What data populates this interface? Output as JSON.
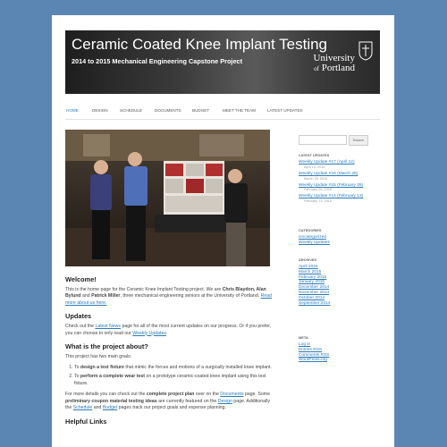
{
  "header": {
    "title": "Ceramic Coated Knee Implant Testing",
    "subtitle": "2014 to 2015 Mechanical Engineering Capstone Project",
    "logo_university": "University",
    "logo_of": "of",
    "logo_portland": "Portland"
  },
  "nav": {
    "items": [
      "HOME",
      "DESIGN",
      "SCHEDULE",
      "DOCUMENTS",
      "BUDGET",
      "MEET THE TEAM",
      "LATEST UPDATES"
    ]
  },
  "main": {
    "welcome_title": "Welcome!",
    "welcome_p1": "This is the home page for the Ceramic Knee Implant Testing project. We are ",
    "names1": "Chris Blaydon, Alan Bylund",
    "and": " and ",
    "names2": "Patrick Miller",
    "welcome_p2": ", three mechanical engineering seniors at the University of Portland. ",
    "read_more": "Read more about us here.",
    "updates_title": "Updates",
    "updates_p1": "Check out the ",
    "latest_news": "Latest News",
    "updates_p2": " page for all of the most current updates on our progress. Or if you prefer, you can choose to only read our ",
    "weekly_updates": "Weekly Updates",
    "updates_p3": ".",
    "about_title": "What is the project about?",
    "about_p": "This project has two main goals:",
    "goal1_pre": "To ",
    "goal1_bold": "design a test fixture",
    "goal1_post": " that mimic the forces and motions of a surgically installed knee implant.",
    "goal2_pre": "To ",
    "goal2_bold": "perform a complete wear test",
    "goal2_post": " on a prototype ceramic-coated knee implant using this test fixture.",
    "details_1": "For more details you can check out the ",
    "details_bold1": "complete project plan",
    "details_2": " over on the ",
    "documents_link": "Documents",
    "details_3": " page. Some ",
    "details_bold2": "preliminary coupon material testing ideas",
    "details_4": " are currently featured on the ",
    "design_link": "Design",
    "details_5": " page. Additionally the ",
    "schedule_link": "Schedule",
    "details_6": " and ",
    "budget_link": "Budget",
    "details_7": " pages track our project goals and expense planning.",
    "helpful_title": "Helpful Links"
  },
  "sidebar": {
    "search_button": "Search",
    "latest_title": "LATEST UPDATES",
    "latest": [
      {
        "title": "Weekly Update #17 (April 12)",
        "date": "April 12, 2015"
      },
      {
        "title": "Weekly Update #16 (March 26)",
        "date": "March 25, 2015"
      },
      {
        "title": "Weekly Update #15 (February 26)",
        "date": "February 26, 2015"
      },
      {
        "title": "Weekly Update #14 (February 13)",
        "date": "February 13, 2015"
      }
    ],
    "categories_title": "CATEGORIES",
    "categories": [
      "Uncategorized",
      "Weekly Updates"
    ],
    "archives_title": "ARCHIVES",
    "archives": [
      "April 2015",
      "March 2015",
      "February 2015",
      "January 2015",
      "December 2014",
      "November 2014",
      "October 2014",
      "September 2014"
    ],
    "meta_title": "META",
    "meta": [
      "Log in",
      "Entries RSS",
      "Comments RSS",
      "WordPress.org"
    ]
  },
  "colors": {
    "background": "#5b86b3",
    "link": "#2b7bb9"
  }
}
